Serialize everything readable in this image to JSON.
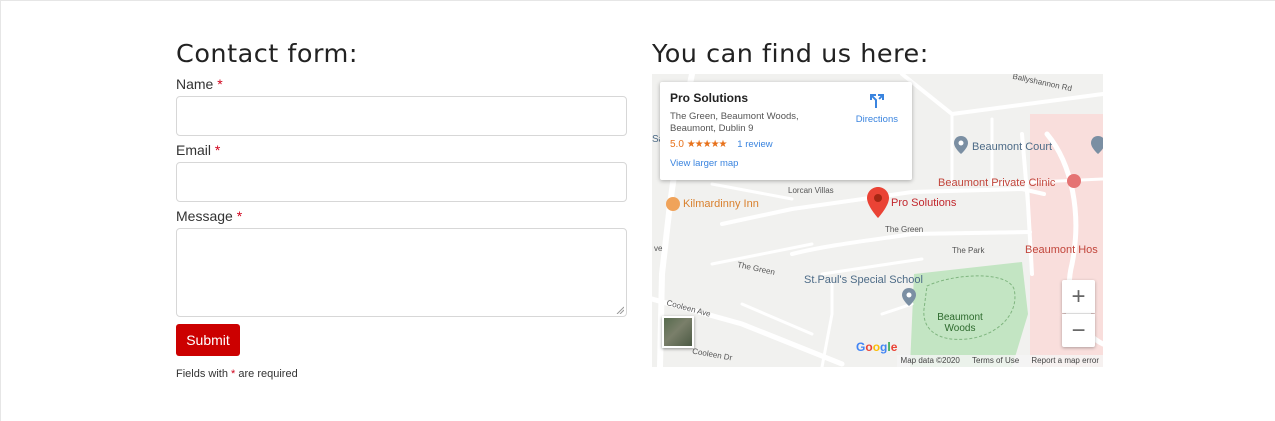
{
  "contact": {
    "title": "Contact form:",
    "name_label": "Name",
    "email_label": "Email",
    "message_label": "Message",
    "required_mark": "*",
    "submit_label": "Submit",
    "note_prefix": "Fields with",
    "note_suffix": "are required"
  },
  "map_section": {
    "title": "You can find us here:",
    "info": {
      "place_name": "Pro Solutions",
      "address_line1": "The Green, Beaumont Woods,",
      "address_line2": "Beaumont, Dublin 9",
      "rating": "5.0",
      "stars": "★★★★★",
      "reviews": "1 review",
      "directions_label": "Directions",
      "larger_map_label": "View larger map"
    },
    "labels": {
      "ballyshannon": "Ballyshannon Rd",
      "beaumont_court": "Beaumont Court",
      "beaumont_clinic": "Beaumont Private Clinic",
      "lorcan_villas": "Lorcan Villas",
      "kilmardinny": "Kilmardinny Inn",
      "marker": "Pro Solutions",
      "the_green_1": "The Green",
      "the_park": "The Park",
      "beaumont_hos": "Beaumont Hos",
      "the_green_2": "The Green",
      "st_pauls": "St.Paul's Special School",
      "beaumont_woods_1": "Beaumont",
      "beaumont_woods_2": "Woods",
      "cooleen": "Cooleen Ave",
      "ave": "ve",
      "sa": "Sa",
      "cooleen_dr": "Cooleen Dr"
    },
    "google_logo": [
      "G",
      "o",
      "o",
      "g",
      "l",
      "e"
    ],
    "attribution": {
      "data": "Map data ©2020",
      "terms": "Terms of Use",
      "report": "Report a map error"
    },
    "zoom_in": "+",
    "zoom_out": "−",
    "colors": {
      "accent_red": "#cc0000",
      "link_blue": "#3a84df",
      "park_green": "#c3e5c3",
      "hospital_pink": "#f9dedc"
    }
  }
}
